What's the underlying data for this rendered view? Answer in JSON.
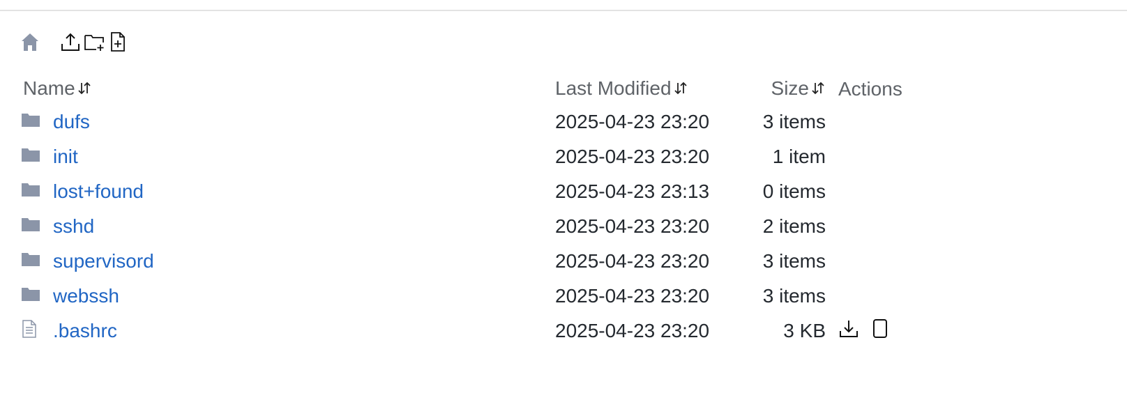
{
  "header": {
    "columns": {
      "name": "Name",
      "last_modified": "Last Modified",
      "size": "Size",
      "actions": "Actions"
    }
  },
  "toolbar": {
    "icons": [
      "home-icon",
      "upload-icon",
      "new-folder-icon",
      "new-file-icon"
    ]
  },
  "files": [
    {
      "type": "folder",
      "name": "dufs",
      "modified": "2025-04-23 23:20",
      "size": "3 items"
    },
    {
      "type": "folder",
      "name": "init",
      "modified": "2025-04-23 23:20",
      "size": "1 item"
    },
    {
      "type": "folder",
      "name": "lost+found",
      "modified": "2025-04-23 23:13",
      "size": "0 items"
    },
    {
      "type": "folder",
      "name": "sshd",
      "modified": "2025-04-23 23:20",
      "size": "2 items"
    },
    {
      "type": "folder",
      "name": "supervisord",
      "modified": "2025-04-23 23:20",
      "size": "3 items"
    },
    {
      "type": "folder",
      "name": "webssh",
      "modified": "2025-04-23 23:20",
      "size": "3 items"
    },
    {
      "type": "file",
      "name": ".bashrc",
      "modified": "2025-04-23 23:20",
      "size": "3 KB",
      "actions": [
        "download-icon",
        "view-icon"
      ]
    }
  ],
  "colors": {
    "link": "#2166c4",
    "icon_gray": "#8b95a8",
    "header_text": "#5f6368"
  }
}
